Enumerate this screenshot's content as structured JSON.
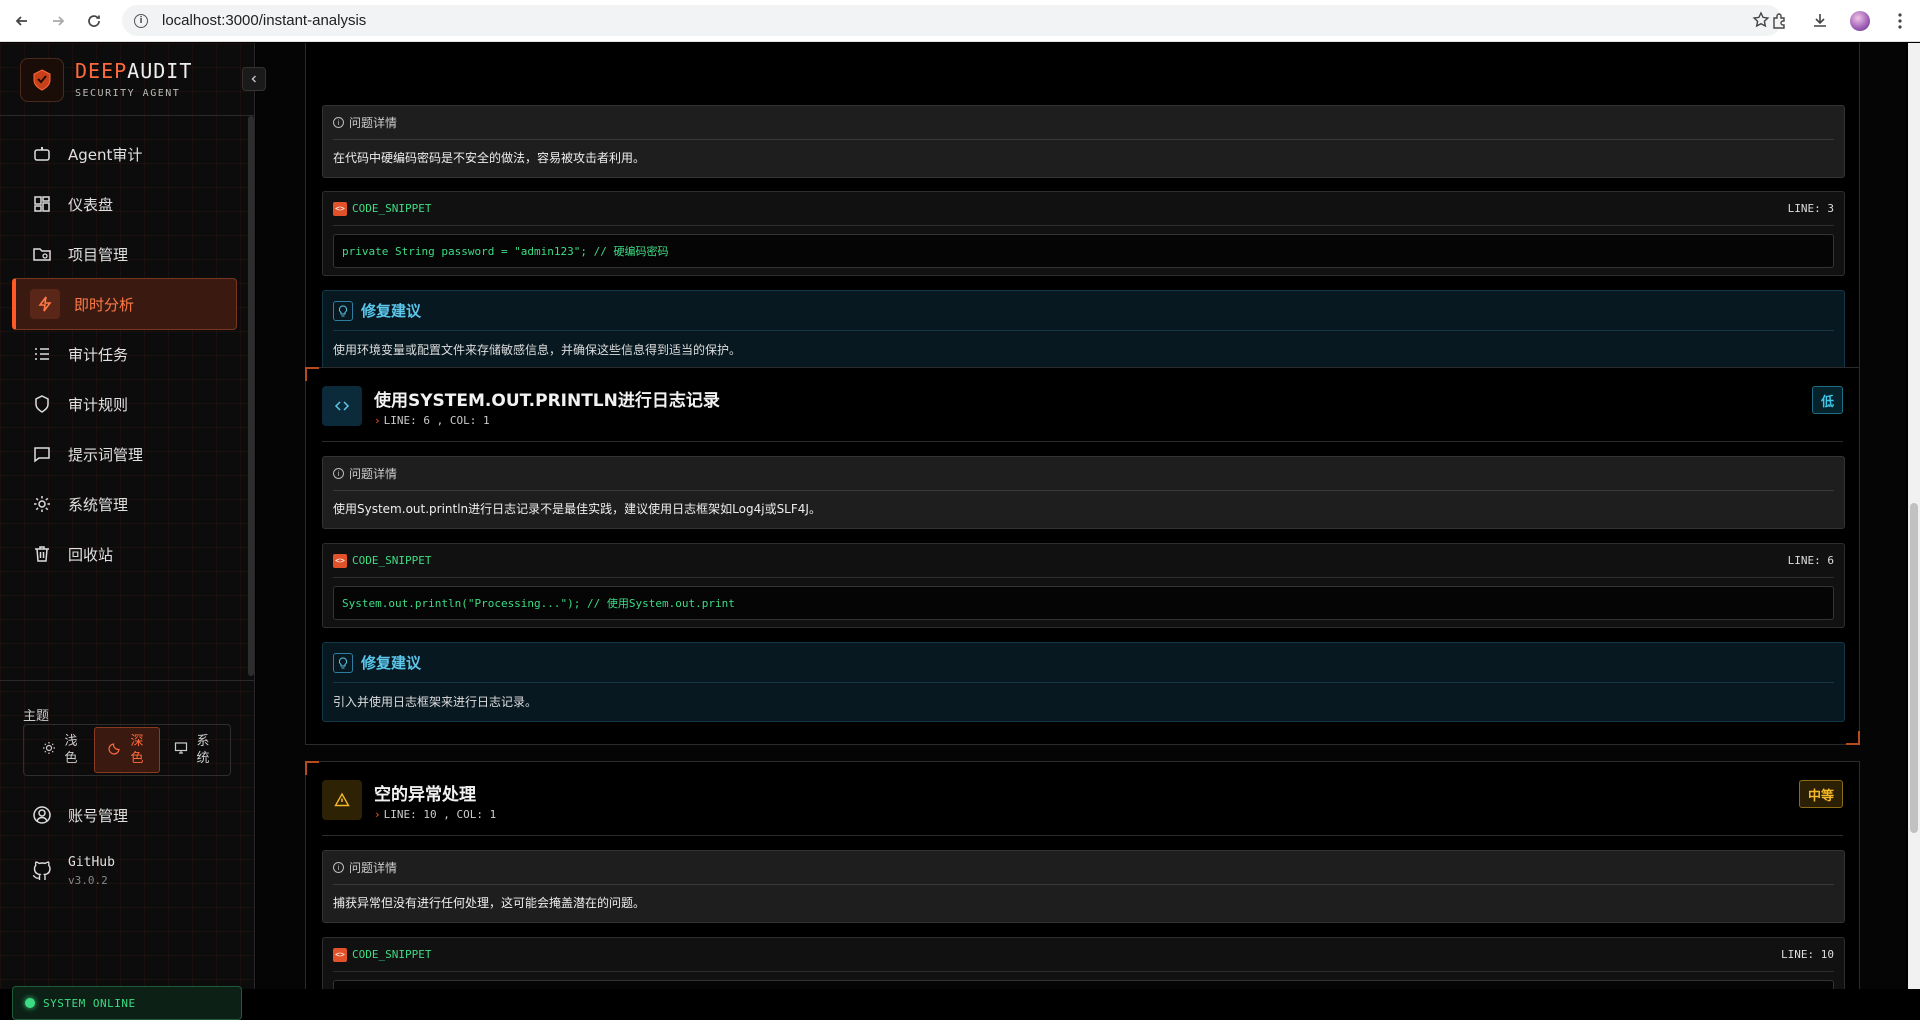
{
  "browser": {
    "url": "localhost:3000/instant-analysis"
  },
  "brand": {
    "title_a": "DEEP",
    "title_b": "AUDIT",
    "subtitle": "SECURITY AGENT"
  },
  "nav": {
    "items": [
      {
        "label": "Agent审计",
        "icon": "bot-icon"
      },
      {
        "label": "仪表盘",
        "icon": "dashboard-icon"
      },
      {
        "label": "项目管理",
        "icon": "folder-icon"
      },
      {
        "label": "即时分析",
        "icon": "lightning-icon",
        "active": true
      },
      {
        "label": "审计任务",
        "icon": "task-list-icon"
      },
      {
        "label": "审计规则",
        "icon": "shield-icon"
      },
      {
        "label": "提示词管理",
        "icon": "message-icon"
      },
      {
        "label": "系统管理",
        "icon": "gear-icon"
      },
      {
        "label": "回收站",
        "icon": "trash-icon"
      }
    ]
  },
  "theme": {
    "label": "主题",
    "options": [
      {
        "label": "浅色",
        "icon": "sun-icon"
      },
      {
        "label": "深色",
        "icon": "moon-icon",
        "active": true
      },
      {
        "label": "系统",
        "icon": "monitor-icon"
      }
    ]
  },
  "account": {
    "label": "账号管理"
  },
  "github": {
    "label": "GitHub",
    "version": "v3.0.2"
  },
  "status": {
    "label": "SYSTEM ONLINE"
  },
  "common": {
    "detail_label": "问题详情",
    "code_label": "CODE_SNIPPET",
    "fix_label": "修复建议"
  },
  "issues": [
    {
      "detail": "在代码中硬编码密码是不安全的做法，容易被攻击者利用。",
      "line_label": "LINE: 3",
      "code": "private String password = \"admin123\"; // 硬编码密码",
      "fix": "使用环境变量或配置文件来存储敏感信息，并确保这些信息得到适当的保护。"
    },
    {
      "title": "使用SYSTEM.OUT.PRINTLN进行日志记录",
      "location": "LINE: 6 , COL: 1",
      "severity": "低",
      "severity_color": "#3fc6e8",
      "detail": "使用System.out.println进行日志记录不是最佳实践，建议使用日志框架如Log4j或SLF4J。",
      "line_label": "LINE: 6",
      "code": "System.out.println(\"Processing...\"); // 使用System.out.print",
      "fix": "引入并使用日志框架来进行日志记录。"
    },
    {
      "title": "空的异常处理",
      "location": "LINE: 10 , COL: 1",
      "severity": "中等",
      "severity_color": "#f5b828",
      "detail": "捕获异常但没有进行任何处理，这可能会掩盖潜在的问题。",
      "line_label": "LINE: 10"
    }
  ]
}
